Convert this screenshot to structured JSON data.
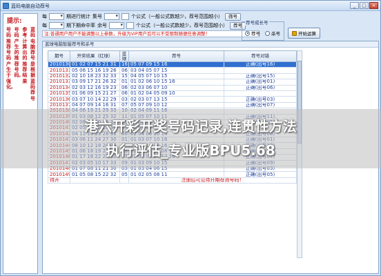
{
  "window": {
    "title": "蓝码电脑自动荐号",
    "buttons": {
      "minimize": "_",
      "maximize": "□",
      "close": "×"
    }
  },
  "hints": {
    "title": "提示:",
    "columns": [
      "蓝码电脑荐号是根据蓝码荐号",
      "参考计算出的推荐结果",
      "号码产生的推荐号码,",
      "号码推荐号码产生于强化,"
    ]
  },
  "controls": {
    "row1": {
      "prefix": "每",
      "combo_value": "",
      "label_stat": "期进行统计",
      "label_ji": "集号",
      "label_formula": "个公式（一般公式数越少，荐号范围越小）"
    },
    "row2": {
      "prefix": "每",
      "label_recommend": "期下期命中率",
      "label_yu": "余号",
      "label_formula": "个公式（一般公式数越少，荐号范围越小）"
    },
    "buttons": {
      "shai": "筛号",
      "shai2": "荐号"
    },
    "warning": "注:普通用户用户不能调整以上参数，升级为VIP用户后可以不受限制随便任意调整！",
    "group": {
      "title": "荐号成长号",
      "options": [
        "荐号",
        "杀号"
      ],
      "selected": "荐号"
    },
    "start_button": "开始运算"
  },
  "table": {
    "caption": "蓝球电脑智能荐号和杀号",
    "headers": [
      "期号",
      "开奖结果（红球）",
      "蓝球",
      "荐号",
      "荐号对错"
    ],
    "rows": [
      {
        "period": "2010130",
        "reds": "01 02 07 15 21 31",
        "blue": "16",
        "rec": "05 07 09 15 16",
        "result": "正确(出号16)",
        "highlight": true
      },
      {
        "period": "2010131",
        "reds": "05 06 15 16 19 26",
        "blue": "06",
        "rec": "03 04 05 07 15",
        "result": "",
        "highlight": false
      },
      {
        "period": "2010132",
        "reds": "02 10 18 23 32 33",
        "blue": "15",
        "rec": "04 05 07 10 15",
        "result": "正确(出号15)",
        "highlight": false
      },
      {
        "period": "2010133",
        "reds": "03 09 17 21 26 32",
        "blue": "01",
        "rec": "01 02 06 10 15 16",
        "result": "正确(出号01)",
        "highlight": false
      },
      {
        "period": "2010134",
        "reds": "02 03 12 16 19 23",
        "blue": "06",
        "rec": "02 03 06 07 10",
        "result": "正确(出号06)",
        "highlight": false
      },
      {
        "period": "2010135",
        "reds": "01 06 09 15 21 27",
        "blue": "06",
        "rec": "01 02 04 05 09 10",
        "result": "",
        "highlight": false
      },
      {
        "period": "2010136",
        "reds": "03 07 10 14 22 29",
        "blue": "03",
        "rec": "02 03 07 13 15",
        "result": "正确(出号03)",
        "highlight": false
      },
      {
        "period": "2010137",
        "reds": "04 07 09 14 16 31",
        "blue": "07",
        "rec": "05 07 09 10 12",
        "result": "正确(出号07)",
        "highlight": false
      },
      {
        "period": "2010138",
        "reds": "04 06 19 21 29 33",
        "blue": "10",
        "rec": "02 04 09 11 16",
        "result": "",
        "highlight": false
      },
      {
        "period": "2010139",
        "reds": "01 03 08 12 25 32",
        "blue": "11",
        "rec": "01 05 07 10 11",
        "result": "正确(出号11)",
        "highlight": false
      },
      {
        "period": "2010140",
        "reds": "02 08 15 20 24 27",
        "blue": "05",
        "rec": "03 05 06 10 15",
        "result": "正确(出号05)",
        "highlight": false
      },
      {
        "period": "2010141",
        "reds": "02 05 16 22 29 33",
        "blue": "07",
        "rec": "02 03 05 09 14",
        "result": "",
        "highlight": false
      },
      {
        "period": "2010142",
        "reds": "04 11 13 21 26 31",
        "blue": "06",
        "rec": "02 04 06 10 14",
        "result": "正确(出号06)",
        "highlight": false
      },
      {
        "period": "2010143",
        "reds": "03 06 11 24 27 30",
        "blue": "01",
        "rec": "01 03 07 10 16",
        "result": "正确(出号01)",
        "highlight": false
      },
      {
        "period": "2010144",
        "reds": "08 10 12 18 20 25",
        "blue": "13",
        "rec": "03 07 12 13 16",
        "result": "正确(出号13)",
        "highlight": false
      },
      {
        "period": "2010145",
        "reds": "01 06 18 19 27 32",
        "blue": "08",
        "rec": "01 02 03 04 08 16",
        "result": "正确(出号08)",
        "highlight": false
      },
      {
        "period": "2010146",
        "reds": "01 17 18 22 25 32",
        "blue": "07",
        "rec": "02 03 06 07 12 16",
        "result": "正确(出号07)",
        "highlight": false
      },
      {
        "period": "2010147",
        "reds": "02 03 05 10 17 33",
        "blue": "09",
        "rec": "01 03 09 10 15",
        "result": "正确(出号09)",
        "highlight": false
      },
      {
        "period": "2010148",
        "reds": "01 07 08 11 21 30",
        "blue": "03",
        "rec": "01 03 04 06 15",
        "result": "正确(出号03)",
        "highlight": false
      },
      {
        "period": "2010149",
        "reds": "01 05 08 15 22 32",
        "blue": "05",
        "rec": "01 02 05 08 11",
        "result": "正确(出号05)",
        "highlight": false
      },
      {
        "period": "待开",
        "reds": "",
        "blue": "",
        "rec": "注册后可见待开期荐测号码！",
        "result": "",
        "highlight": false,
        "pending": true
      }
    ]
  },
  "watermark": {
    "line1": "港六开彩开奖号码记录,连贯性方法",
    "line2": "执行评估_专业版BPU5.68"
  }
}
